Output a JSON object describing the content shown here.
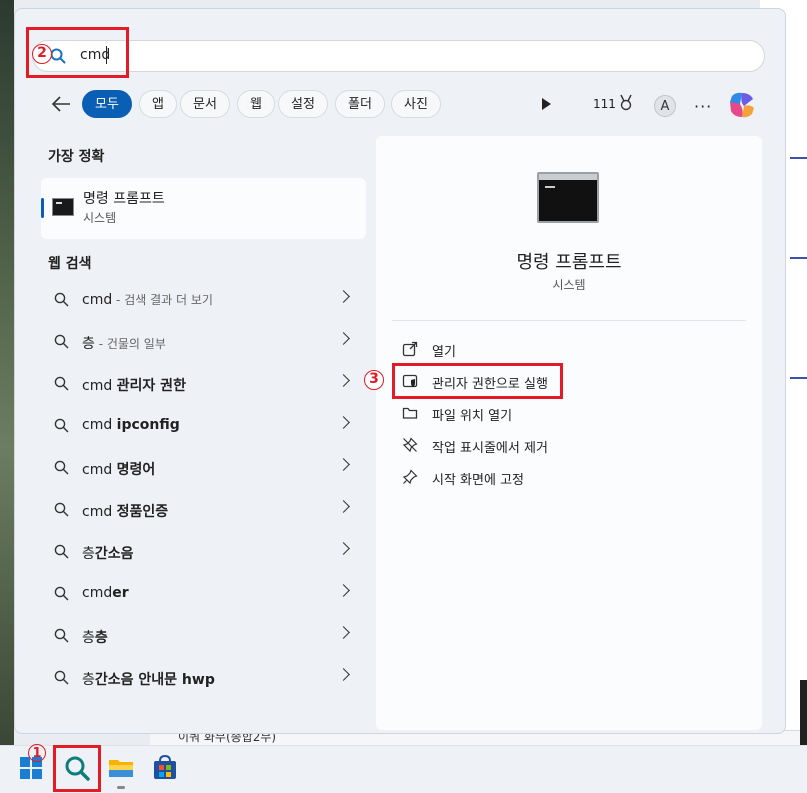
{
  "background": {
    "bottom_text": "이쿼 화무(종합2무)"
  },
  "search": {
    "value": "cmd"
  },
  "annotations": {
    "step1": "1",
    "step2": "2",
    "step3": "3"
  },
  "filters": {
    "tabs": [
      "모두",
      "앱",
      "문서",
      "웹",
      "설정",
      "폴더",
      "사진"
    ],
    "active": "모두",
    "points": "111",
    "avatar_letter": "A",
    "more": "···"
  },
  "results": {
    "best_match_heading": "가장 정확",
    "best_match": {
      "title": "명령 프롬프트",
      "subtitle": "시스템"
    },
    "web_heading": "웹 검색",
    "web_items": [
      {
        "main": "cmd",
        "bold": "",
        "note": " - 검색 결과 더 보기"
      },
      {
        "main": "층",
        "bold": "",
        "note": " - 건물의 일부"
      },
      {
        "main": "cmd ",
        "bold": "관리자 권한",
        "note": ""
      },
      {
        "main": "cmd ",
        "bold": "ipconfig",
        "note": ""
      },
      {
        "main": "cmd ",
        "bold": "명령어",
        "note": ""
      },
      {
        "main": "cmd ",
        "bold": "정품인증",
        "note": ""
      },
      {
        "main": "층",
        "bold": "간소음",
        "note": ""
      },
      {
        "main": "cmd",
        "bold": "er",
        "note": ""
      },
      {
        "main": "층",
        "bold": "층",
        "note": ""
      },
      {
        "main": "층",
        "bold": "간소음 안내문 hwp",
        "note": ""
      }
    ]
  },
  "detail": {
    "title": "명령 프롬프트",
    "subtitle": "시스템",
    "actions": [
      {
        "label": "열기",
        "icon": "open-external-icon"
      },
      {
        "label": "관리자 권한으로 실행",
        "icon": "shield-admin-icon"
      },
      {
        "label": "파일 위치 열기",
        "icon": "folder-icon"
      },
      {
        "label": "작업 표시줄에서 제거",
        "icon": "unpin-icon"
      },
      {
        "label": "시작 화면에 고정",
        "icon": "pin-icon"
      }
    ]
  },
  "colors": {
    "accent": "#0a5fb4",
    "annotation_red": "#e21b26"
  }
}
